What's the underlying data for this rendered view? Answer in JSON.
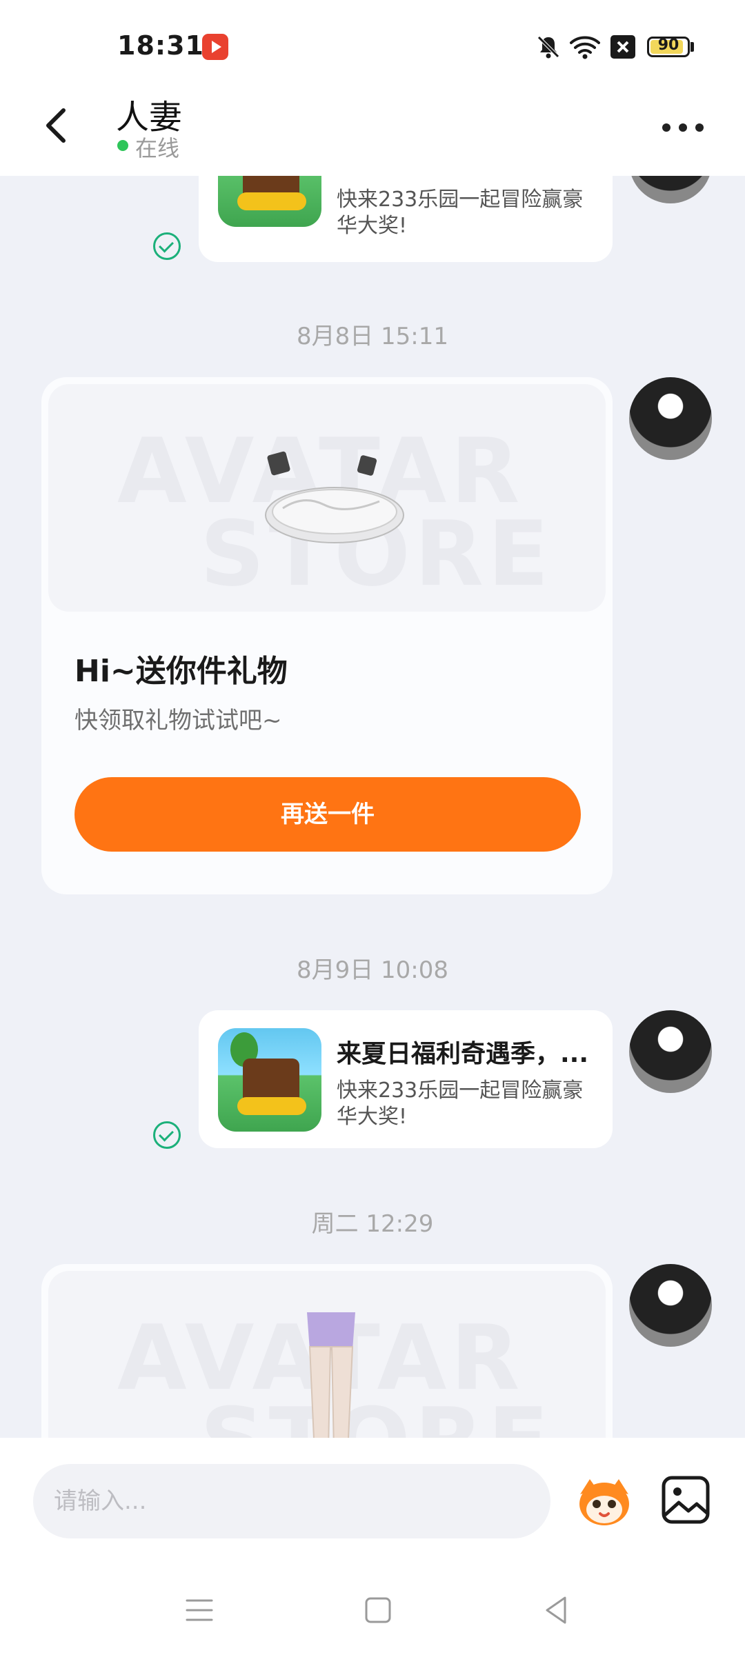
{
  "status_bar": {
    "time": "18:31",
    "battery": "90",
    "battery_level": 0.9,
    "icons": [
      "app-notification-icon",
      "mute-icon",
      "wifi-icon",
      "no-sim-icon",
      "battery-icon"
    ]
  },
  "header": {
    "title": "人妻",
    "status": "在线",
    "status_color": "#2fc55a"
  },
  "chat": {
    "messages": [
      {
        "type": "game_card",
        "desc": "快来233乐园一起冒险赢豪华大奖!",
        "read": true
      },
      {
        "type": "timestamp",
        "text": "8月8日 15:11"
      },
      {
        "type": "gift_card",
        "watermark_top": "AVATAR",
        "watermark_bottom": "STORE",
        "title": "Hi~送你件礼物",
        "subtitle": "快领取礼物试试吧~",
        "button": "再送一件"
      },
      {
        "type": "timestamp",
        "text": "8月9日 10:08"
      },
      {
        "type": "game_card",
        "title": "来夏日福利奇遇季，...",
        "desc": "快来233乐园一起冒险赢豪华大奖!",
        "read": true
      },
      {
        "type": "timestamp",
        "text": "周二 12:29"
      },
      {
        "type": "gift_card_partial",
        "watermark_top": "AVATAR",
        "watermark_bottom": "STORE"
      }
    ]
  },
  "composer": {
    "placeholder": "请输入...",
    "emoji_icon": "mascot-emoji-icon",
    "image_icon": "image-icon"
  },
  "colors": {
    "accent_orange": "#ff7413",
    "read_check": "#1bb07a",
    "chat_bg": "#eff1f7"
  },
  "nav": [
    "menu-icon",
    "home-icon",
    "back-triangle-icon"
  ]
}
